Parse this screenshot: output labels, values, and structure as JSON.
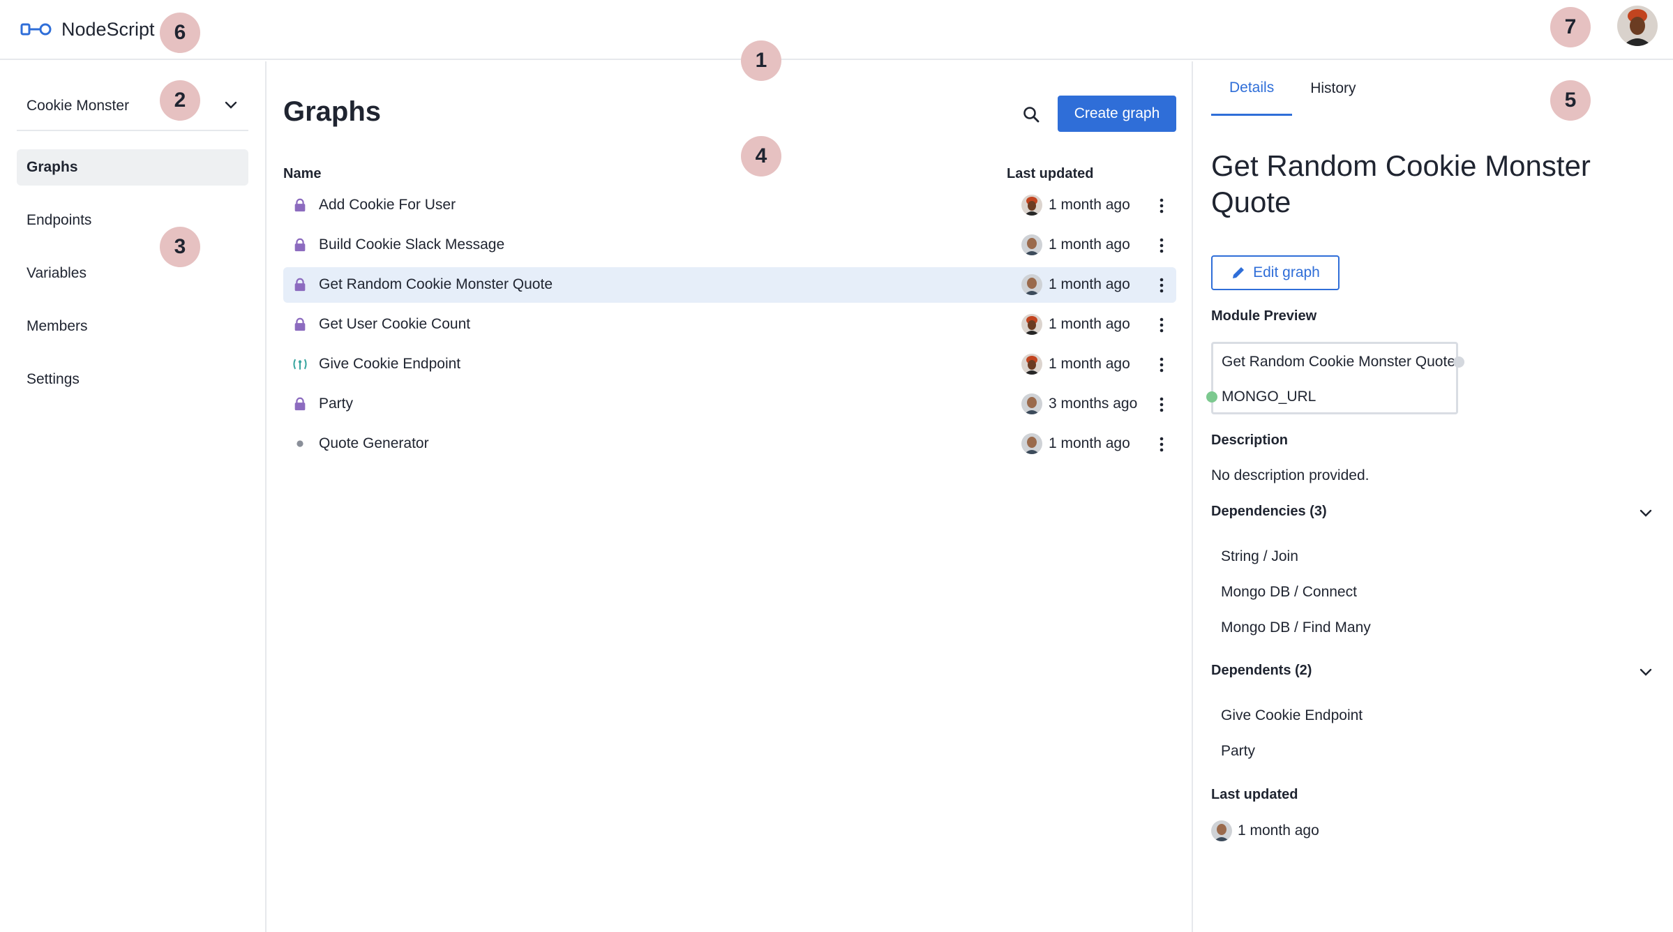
{
  "app": {
    "name": "NodeScript"
  },
  "badges": [
    "1",
    "2",
    "3",
    "4",
    "5",
    "6",
    "7"
  ],
  "sidebar": {
    "workspace": "Cookie Monster",
    "items": [
      {
        "label": "Graphs",
        "active": true
      },
      {
        "label": "Endpoints"
      },
      {
        "label": "Variables"
      },
      {
        "label": "Members"
      },
      {
        "label": "Settings"
      }
    ]
  },
  "main": {
    "title": "Graphs",
    "create_label": "Create graph",
    "columns": {
      "name": "Name",
      "updated": "Last updated"
    },
    "rows": [
      {
        "name": "Add Cookie For User",
        "icon": "lock-icon",
        "updated": "1 month ago"
      },
      {
        "name": "Build Cookie Slack Message",
        "icon": "lock-icon",
        "updated": "1 month ago"
      },
      {
        "name": "Get Random Cookie Monster Quote",
        "icon": "lock-icon",
        "updated": "1 month ago",
        "selected": true
      },
      {
        "name": "Get User Cookie Count",
        "icon": "lock-icon",
        "updated": "1 month ago"
      },
      {
        "name": "Give Cookie Endpoint",
        "icon": "endpoint-icon",
        "updated": "1 month ago"
      },
      {
        "name": "Party",
        "icon": "lock-icon",
        "updated": "3 months ago"
      },
      {
        "name": "Quote Generator",
        "icon": "dot-icon",
        "updated": "1 month ago"
      }
    ]
  },
  "panel": {
    "tabs": [
      "Details",
      "History"
    ],
    "title": "Get Random Cookie Monster Quote",
    "edit_label": "Edit graph",
    "module_preview_label": "Module Preview",
    "module_name": "Get Random Cookie Monster Quote",
    "module_var": "MONGO_URL",
    "description_label": "Description",
    "description": "No description provided.",
    "dependencies_label": "Dependencies (3)",
    "dependencies": [
      "String / Join",
      "Mongo DB / Connect",
      "Mongo DB / Find Many"
    ],
    "dependents_label": "Dependents (2)",
    "dependents": [
      "Give Cookie Endpoint",
      "Party"
    ],
    "last_updated_label": "Last updated",
    "last_updated": "1 month ago"
  },
  "colors": {
    "accent": "#2f6ed8",
    "lock": "#8c6bbf",
    "endpoint": "#3aa6a0",
    "badge": "#e6c1c1",
    "selected_row": "#e6eef9"
  }
}
